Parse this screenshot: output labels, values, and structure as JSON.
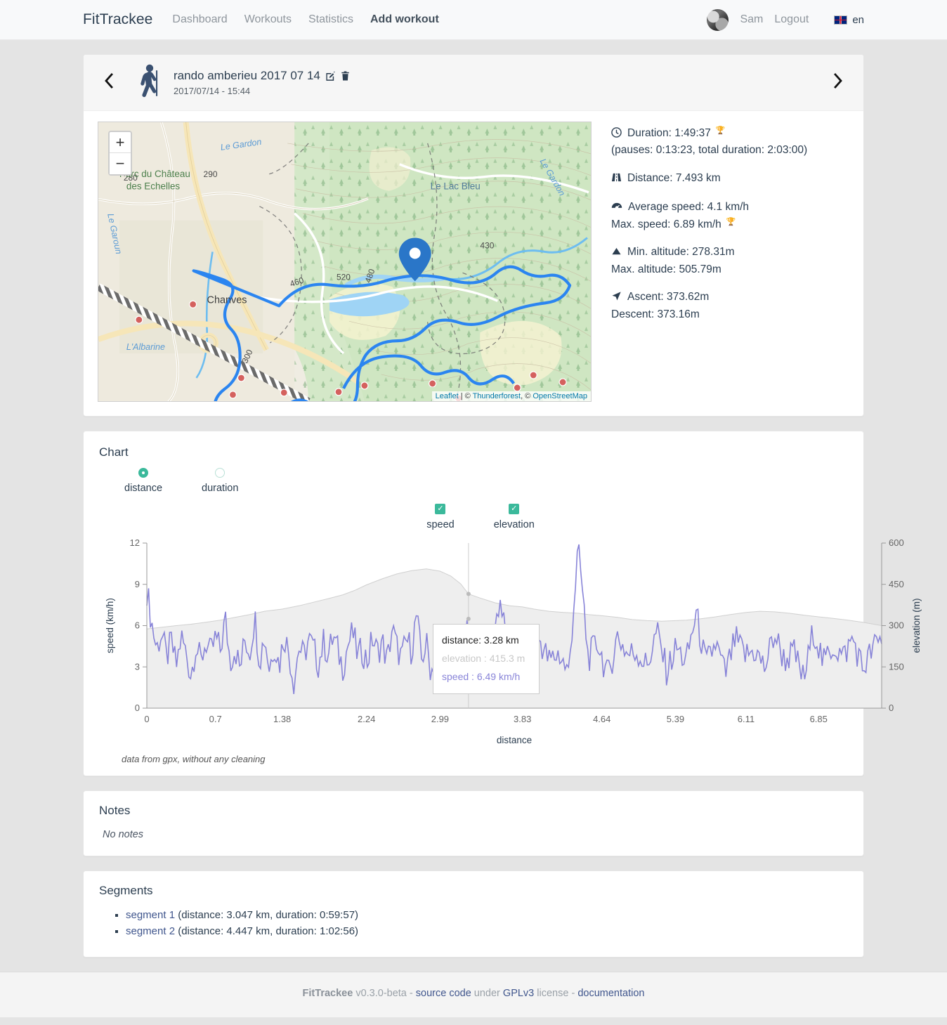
{
  "navbar": {
    "brand": "FitTrackee",
    "links": [
      {
        "label": "Dashboard",
        "active": false
      },
      {
        "label": "Workouts",
        "active": false
      },
      {
        "label": "Statistics",
        "active": false
      },
      {
        "label": "Add workout",
        "active": true
      }
    ],
    "username": "Sam",
    "logout": "Logout",
    "language": "en",
    "avatar_name": "user-avatar"
  },
  "workout": {
    "prev_icon": "chevron-left-icon",
    "next_icon": "chevron-right-icon",
    "sport_icon": "hiking-icon",
    "title": "rando amberieu 2017 07 14",
    "edit_icon": "edit-icon",
    "delete_icon": "trash-icon",
    "date": "2017/07/14 - 15:44"
  },
  "map": {
    "zoom_in": "+",
    "zoom_out": "−",
    "attribution_prefix": "Leaflet",
    "attribution_sep1": " | © ",
    "attribution_thunderforest": "Thunderforest",
    "attribution_sep2": ", © ",
    "attribution_osm": "OpenStreetMap",
    "labels": {
      "gardon": "Le Gardon",
      "gardon2": "Le Gardon",
      "parc1": "Parc du Château",
      "parc2": "des Echelles",
      "garoun": "Le Garoun",
      "lac": "Le Lac Bleu",
      "chanves": "Chanves",
      "albarine": "L'Albarine",
      "c280": "280",
      "c290": "290",
      "c430": "430",
      "c460": "460",
      "c480": "480",
      "c520": "520",
      "c300": "300"
    }
  },
  "stats": {
    "duration_icon": "clock-icon",
    "duration_label": "Duration: 1:49:37",
    "pauses_label": "(pauses: 0:13:23, total duration: 2:03:00)",
    "distance_icon": "road-icon",
    "distance_label": "Distance: 7.493 km",
    "speed_icon": "tachometer-icon",
    "avg_speed_label": "Average speed: 4.1 km/h",
    "max_speed_label": "Max. speed: 6.89 km/h",
    "altitude_icon": "mountain-icon",
    "min_alt_label": "Min. altitude: 278.31m",
    "max_alt_label": "Max. altitude: 505.79m",
    "ascent_icon": "location-arrow-icon",
    "ascent_label": "Ascent: 373.62m",
    "descent_label": "Descent: 373.16m",
    "trophy": "🏆"
  },
  "chart": {
    "title": "Chart",
    "radios": [
      {
        "label": "distance",
        "selected": true
      },
      {
        "label": "duration",
        "selected": false
      }
    ],
    "checkboxes": [
      {
        "label": "speed",
        "checked": true
      },
      {
        "label": "elevation",
        "checked": true
      }
    ],
    "note": "data from gpx, without any cleaning",
    "tooltip": {
      "distance": "distance: 3.28 km",
      "elevation": "elevation : 415.3 m",
      "speed": "speed : 6.49 km/h"
    }
  },
  "chart_data": {
    "type": "line",
    "title": "Chart",
    "xlabel": "distance",
    "ylabel": "speed (km/h)",
    "y2label": "elevation (m)",
    "xticks": [
      "0",
      "0.7",
      "1.38",
      "2.24",
      "2.99",
      "3.83",
      "4.64",
      "5.39",
      "6.11",
      "6.85"
    ],
    "xtick_values": [
      0,
      0.7,
      1.38,
      2.24,
      2.99,
      3.83,
      4.64,
      5.39,
      6.11,
      6.85
    ],
    "xlim": [
      0,
      7.493
    ],
    "yticks": [
      "0",
      "3",
      "6",
      "9",
      "12"
    ],
    "ytick_values": [
      0,
      3,
      6,
      9,
      12
    ],
    "ylim": [
      0,
      12
    ],
    "y2ticks": [
      "600",
      "450",
      "300",
      "150",
      "0"
    ],
    "y2tick_values": [
      600,
      450,
      300,
      150,
      0
    ],
    "y2lim": [
      0,
      600
    ],
    "grid": false,
    "legend_position": "top",
    "colors": {
      "speed": "#8884d8",
      "elevation": "#eeeeee",
      "elevation_stroke": "#d0d0d0"
    },
    "series": [
      {
        "name": "elevation",
        "unit": "m",
        "axis": "right",
        "kind": "area",
        "x": [
          0,
          0.1,
          0.2,
          0.3,
          0.45,
          0.6,
          0.75,
          0.9,
          1.05,
          1.2,
          1.38,
          1.55,
          1.7,
          1.85,
          2.0,
          2.12,
          2.24,
          2.4,
          2.55,
          2.7,
          2.85,
          2.99,
          3.1,
          3.2,
          3.28,
          3.4,
          3.55,
          3.7,
          3.83,
          3.95,
          4.1,
          4.25,
          4.4,
          4.5,
          4.64,
          4.8,
          4.95,
          5.1,
          5.25,
          5.39,
          5.5,
          5.65,
          5.8,
          5.95,
          6.11,
          6.25,
          6.4,
          6.55,
          6.7,
          6.85,
          7.0,
          7.15,
          7.3,
          7.493
        ],
        "values": [
          288,
          292,
          296,
          300,
          305,
          312,
          320,
          330,
          340,
          352,
          360,
          372,
          385,
          398,
          412,
          428,
          448,
          470,
          488,
          500,
          506,
          498,
          480,
          452,
          415,
          400,
          383,
          372,
          368,
          360,
          352,
          348,
          345,
          340,
          336,
          330,
          322,
          318,
          316,
          318,
          320,
          325,
          332,
          340,
          348,
          352,
          350,
          345,
          338,
          332,
          326,
          320,
          312,
          300
        ]
      },
      {
        "name": "speed",
        "unit": "km/h",
        "axis": "left",
        "kind": "line",
        "summary": "Highly oscillating walking speed, mostly between 2 and 7 km/h, starting near 8.6 km/h, with a deep dip near 1.9 km and peaks reaching ~11.9 km/h near 4.4 km.",
        "x": [
          0,
          0.05,
          0.1,
          0.15,
          0.2,
          0.25,
          0.3,
          0.35,
          0.4,
          0.45,
          0.5,
          0.55,
          0.6,
          0.65,
          0.7,
          0.75,
          0.8,
          0.85,
          0.9,
          0.95,
          1.0,
          1.05,
          1.1,
          1.15,
          1.2,
          1.25,
          1.3,
          1.35,
          1.4,
          1.45,
          1.5,
          1.55,
          1.6,
          1.65,
          1.7,
          1.75,
          1.8,
          1.85,
          1.9,
          1.95,
          2.0,
          2.05,
          2.1,
          2.15,
          2.2,
          2.25,
          2.3,
          2.35,
          2.4,
          2.45,
          2.5,
          2.55,
          2.6,
          2.65,
          2.7,
          2.75,
          2.8,
          2.85,
          2.9,
          2.95,
          3.0,
          3.05,
          3.1,
          3.15,
          3.2,
          3.28,
          3.35,
          3.4,
          3.45,
          3.5,
          3.6,
          3.7,
          3.8,
          3.9,
          4.0,
          4.1,
          4.2,
          4.3,
          4.4,
          4.5,
          4.6,
          4.7,
          4.8,
          4.9,
          5.0,
          5.1,
          5.2,
          5.3,
          5.4,
          5.5,
          5.6,
          5.7,
          5.8,
          5.9,
          6.0,
          6.1,
          6.2,
          6.3,
          6.4,
          6.5,
          6.6,
          6.7,
          6.8,
          6.9,
          7.0,
          7.1,
          7.2,
          7.3,
          7.4,
          7.493
        ],
        "values": [
          8.6,
          6.2,
          4.3,
          5.5,
          3.6,
          4.8,
          3.0,
          5.2,
          4.0,
          2.4,
          4.6,
          3.3,
          4.9,
          3.8,
          5.1,
          4.2,
          6.5,
          3.4,
          4.4,
          2.8,
          5.0,
          4.1,
          6.7,
          3.5,
          5.3,
          2.9,
          4.7,
          3.1,
          5.4,
          4.0,
          1.9,
          4.5,
          3.7,
          5.0,
          4.3,
          3.2,
          4.8,
          3.9,
          5.2,
          4.1,
          3.0,
          4.6,
          5.5,
          3.8,
          4.2,
          3.4,
          5.1,
          4.0,
          4.9,
          3.3,
          5.8,
          4.4,
          3.6,
          5.0,
          4.2,
          6.8,
          3.5,
          4.7,
          2.6,
          3.9,
          3.0,
          4.4,
          2.2,
          3.5,
          2.0,
          6.49,
          2.9,
          4.5,
          3.1,
          3.8,
          8.0,
          3.2,
          4.6,
          2.8,
          5.1,
          3.4,
          4.0,
          2.5,
          11.9,
          3.6,
          4.8,
          2.2,
          5.3,
          3.9,
          4.1,
          3.0,
          5.6,
          2.7,
          4.4,
          3.3,
          6.9,
          3.1,
          4.7,
          2.4,
          5.0,
          3.8,
          4.2,
          2.9,
          5.4,
          3.5,
          4.0,
          2.0,
          5.8,
          3.2,
          4.6,
          3.7,
          5.1,
          2.8,
          4.3,
          5.0,
          3.4,
          4.9
        ]
      }
    ]
  },
  "notes": {
    "title": "Notes",
    "empty": "No notes"
  },
  "segments": {
    "title": "Segments",
    "items": [
      {
        "link": "segment 1",
        "detail": " (distance: 3.047 km, duration: 0:59:57)"
      },
      {
        "link": "segment 2",
        "detail": " (distance: 4.447 km, duration: 1:02:56)"
      }
    ]
  },
  "footer": {
    "brand": "FitTrackee",
    "version": " v0.3.0-beta - ",
    "source": "source code",
    "under": " under ",
    "license": "GPLv3",
    "license_suffix": " license - ",
    "documentation": "documentation"
  }
}
